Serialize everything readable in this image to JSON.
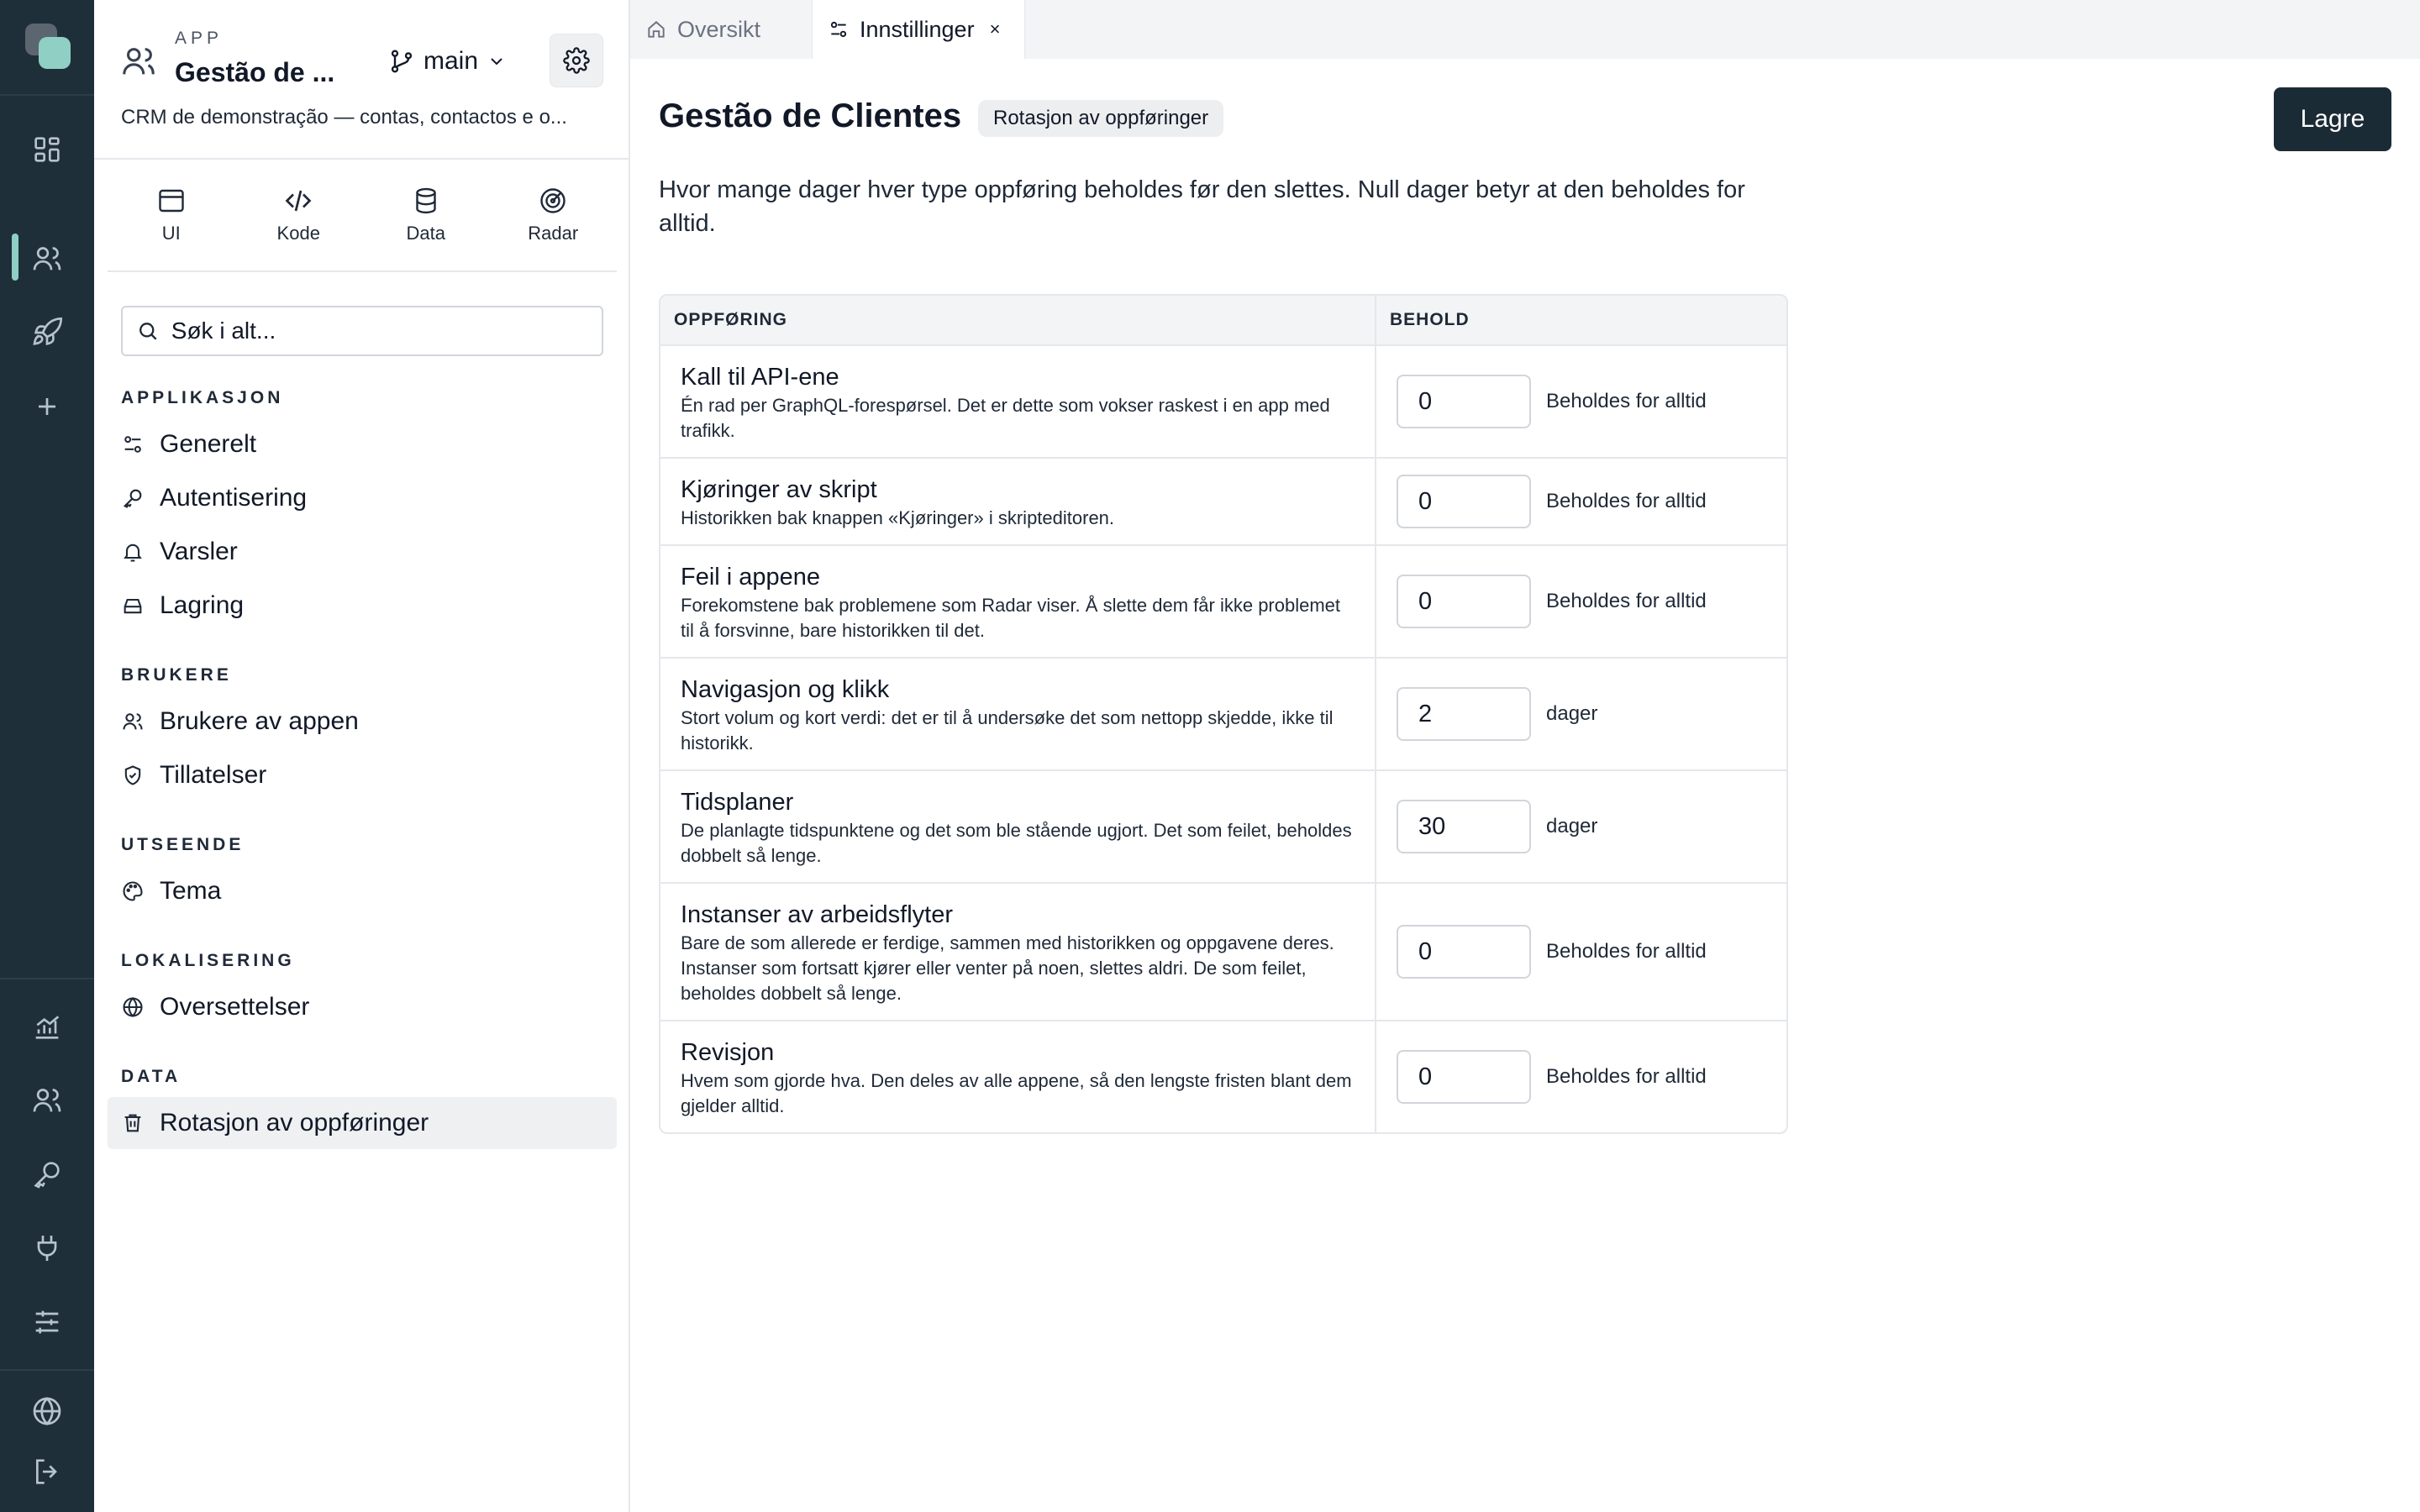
{
  "rail": {
    "icons": [
      "apps-grid-icon",
      "users-icon",
      "rocket-icon",
      "plus-icon",
      "chart-icon",
      "users-icon",
      "key-icon",
      "plug-icon",
      "sliders-icon",
      "globe-icon",
      "logout-icon"
    ],
    "accent": "#8fcfc4"
  },
  "app": {
    "eyebrow": "APP",
    "name": "Gestão de ...",
    "branch": "main",
    "description": "CRM de demonstração — contas, contactos e o..."
  },
  "modes": [
    {
      "label": "UI",
      "icon": "window-icon"
    },
    {
      "label": "Kode",
      "icon": "code-icon"
    },
    {
      "label": "Data",
      "icon": "database-icon"
    },
    {
      "label": "Radar",
      "icon": "radar-icon"
    }
  ],
  "search": {
    "placeholder": "Søk i alt..."
  },
  "sections": {
    "applikasjon": "APPLIKASJON",
    "brukere": "BRUKERE",
    "utseende": "UTSEENDE",
    "lokalisering": "LOKALISERING",
    "data": "DATA"
  },
  "nav": {
    "generelt": "Generelt",
    "autentisering": "Autentisering",
    "varsler": "Varsler",
    "lagring": "Lagring",
    "brukere_av_appen": "Brukere av appen",
    "tillatelser": "Tillatelser",
    "tema": "Tema",
    "oversettelser": "Oversettelser",
    "rotasjon": "Rotasjon av oppføringer"
  },
  "tabs": [
    {
      "label": "Oversikt",
      "icon": "home-icon",
      "active": false
    },
    {
      "label": "Innstillinger",
      "icon": "sliders-icon",
      "active": true,
      "close": "×"
    }
  ],
  "main": {
    "title": "Gestão de Clientes",
    "badge": "Rotasjon av oppføringer",
    "save_label": "Lagre",
    "intro": "Hvor mange dager hver type oppføring beholdes før den slettes. Null dager betyr at den beholdes for alltid.",
    "table": {
      "headers": [
        "OPPFØRING",
        "BEHOLD"
      ],
      "rows": [
        {
          "name": "Kall til API-ene",
          "desc": "Én rad per GraphQL-forespørsel. Det er dette som vokser raskest i en app med trafikk.",
          "value": "0",
          "unit": "Beholdes for alltid"
        },
        {
          "name": "Kjøringer av skript",
          "desc": "Historikken bak knappen «Kjøringer» i skripteditoren.",
          "value": "0",
          "unit": "Beholdes for alltid"
        },
        {
          "name": "Feil i appene",
          "desc": "Forekomstene bak problemene som Radar viser. Å slette dem får ikke problemet til å forsvinne, bare historikken til det.",
          "value": "0",
          "unit": "Beholdes for alltid"
        },
        {
          "name": "Navigasjon og klikk",
          "desc": "Stort volum og kort verdi: det er til å undersøke det som nettopp skjedde, ikke til historikk.",
          "value": "2",
          "unit": "dager"
        },
        {
          "name": "Tidsplaner",
          "desc": "De planlagte tidspunktene og det som ble stående ugjort. Det som feilet, beholdes dobbelt så lenge.",
          "value": "30",
          "unit": "dager"
        },
        {
          "name": "Instanser av arbeidsflyter",
          "desc": "Bare de som allerede er ferdige, sammen med historikken og oppgavene deres. Instanser som fortsatt kjører eller venter på noen, slettes aldri. De som feilet, beholdes dobbelt så lenge.",
          "value": "0",
          "unit": "Beholdes for alltid"
        },
        {
          "name": "Revisjon",
          "desc": "Hvem som gjorde hva. Den deles av alle appene, så den lengste fristen blant dem gjelder alltid.",
          "value": "0",
          "unit": "Beholdes for alltid"
        }
      ]
    }
  }
}
